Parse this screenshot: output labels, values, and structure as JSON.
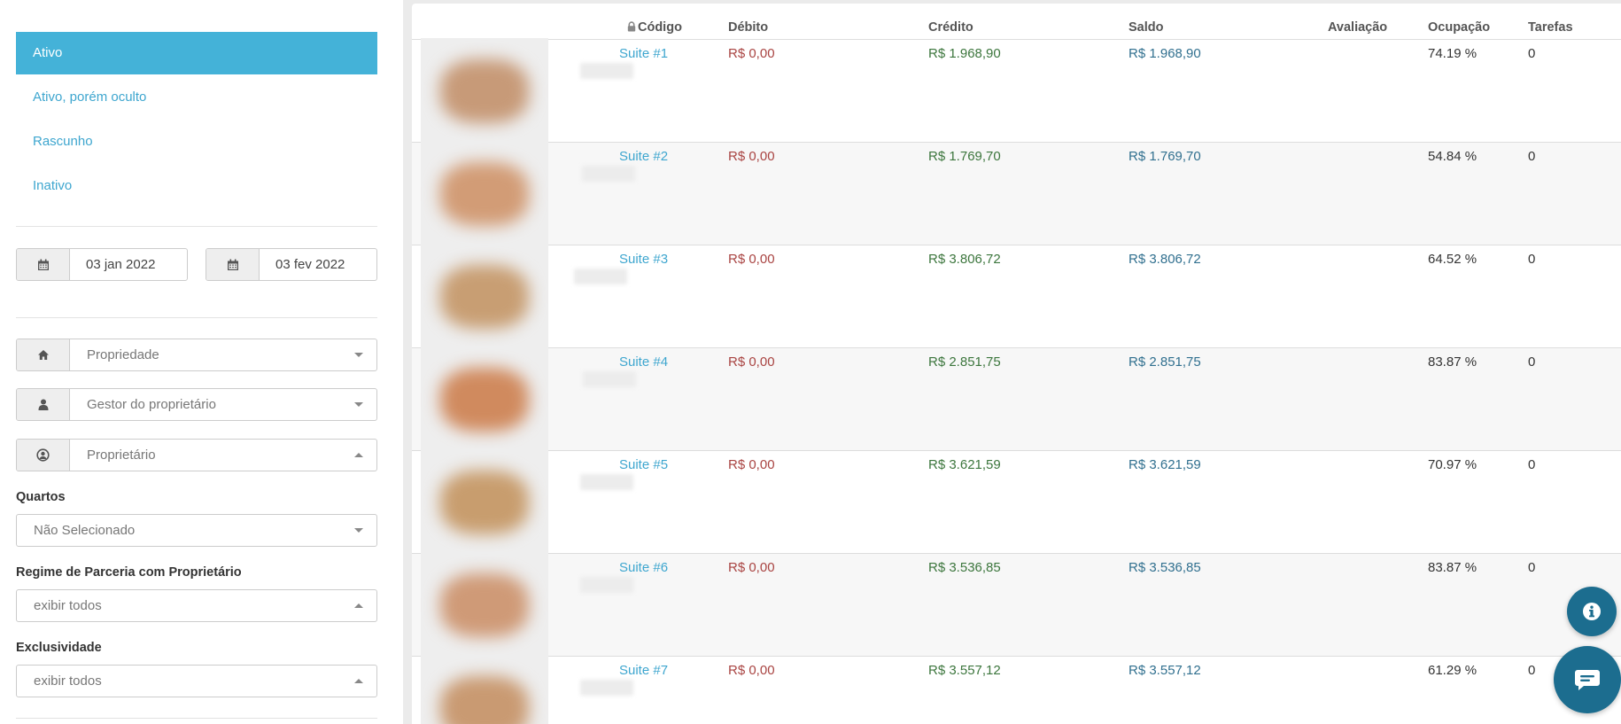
{
  "sidebar": {
    "status_items": [
      {
        "label": "Ativo",
        "active": true
      },
      {
        "label": "Ativo, porém oculto",
        "active": false
      },
      {
        "label": "Rascunho",
        "active": false
      },
      {
        "label": "Inativo",
        "active": false
      }
    ],
    "date_from": "03 jan 2022",
    "date_to": "03 fev 2022",
    "property_placeholder": "Propriedade",
    "owner_manager_placeholder": "Gestor do proprietário",
    "owner_placeholder": "Proprietário",
    "rooms_label": "Quartos",
    "rooms_value": "Não Selecionado",
    "partnership_label": "Regime de Parceria com Proprietário",
    "partnership_value": "exibir todos",
    "exclusivity_label": "Exclusividade",
    "exclusivity_value": "exibir todos"
  },
  "table": {
    "headers": {
      "code": "Código",
      "debit": "Débito",
      "credit": "Crédito",
      "balance": "Saldo",
      "rating": "Avaliação",
      "occupancy": "Ocupação",
      "tasks": "Tarefas"
    },
    "rows": [
      {
        "code": "Suite #1",
        "debit": "R$ 0,00",
        "credit": "R$ 1.968,90",
        "balance": "R$ 1.968,90",
        "occupancy": "74.19 %",
        "tasks": "0"
      },
      {
        "code": "Suite #2",
        "debit": "R$ 0,00",
        "credit": "R$ 1.769,70",
        "balance": "R$ 1.769,70",
        "occupancy": "54.84 %",
        "tasks": "0"
      },
      {
        "code": "Suite #3",
        "debit": "R$ 0,00",
        "credit": "R$ 3.806,72",
        "balance": "R$ 3.806,72",
        "occupancy": "64.52 %",
        "tasks": "0"
      },
      {
        "code": "Suite #4",
        "debit": "R$ 0,00",
        "credit": "R$ 2.851,75",
        "balance": "R$ 2.851,75",
        "occupancy": "83.87 %",
        "tasks": "0"
      },
      {
        "code": "Suite #5",
        "debit": "R$ 0,00",
        "credit": "R$ 3.621,59",
        "balance": "R$ 3.621,59",
        "occupancy": "70.97 %",
        "tasks": "0"
      },
      {
        "code": "Suite #6",
        "debit": "R$ 0,00",
        "credit": "R$ 3.536,85",
        "balance": "R$ 3.536,85",
        "occupancy": "83.87 %",
        "tasks": "0"
      },
      {
        "code": "Suite #7",
        "debit": "R$ 0,00",
        "credit": "R$ 3.557,12",
        "balance": "R$ 3.557,12",
        "occupancy": "61.29 %",
        "tasks": "0"
      }
    ]
  },
  "colors": {
    "accent": "#44b2d8",
    "link": "#3ea6cf",
    "debit": "#a94442",
    "credit": "#3c763d",
    "balance": "#31708f",
    "fab": "#1c6d8f"
  },
  "icons": [
    "calendar-icon",
    "home-icon",
    "user-icon",
    "user-circle-icon",
    "lock-icon",
    "info-icon",
    "chat-icon"
  ]
}
